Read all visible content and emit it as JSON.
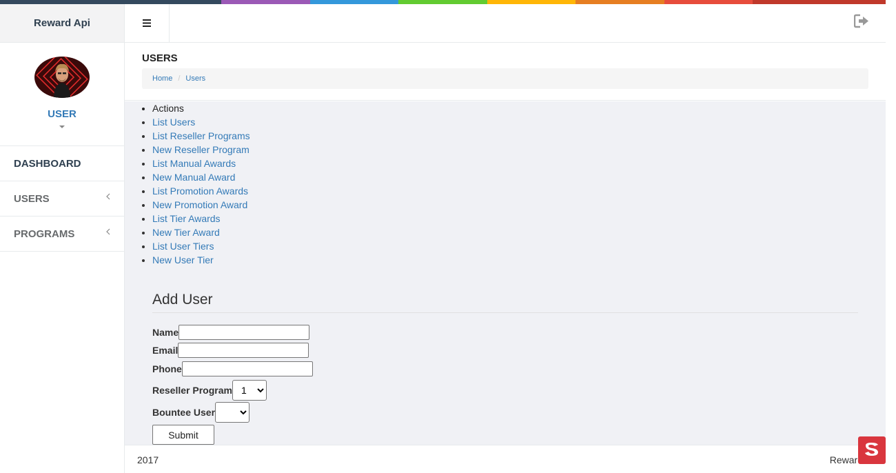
{
  "brand": {
    "name": "Reward Api"
  },
  "profile": {
    "name": "USER"
  },
  "colors": [
    "#34495e",
    "#9b59b6",
    "#3498db",
    "#62cb31",
    "#ffb606",
    "#e67e22",
    "#e74c3c",
    "#c0392b"
  ],
  "sidebar": {
    "items": [
      {
        "label": "DASHBOARD"
      },
      {
        "label": "USERS"
      },
      {
        "label": "PROGRAMS"
      }
    ]
  },
  "page": {
    "title": "USERS",
    "breadcrumb": [
      "Home",
      "Users"
    ]
  },
  "actions": {
    "heading": "Actions",
    "links": [
      "List Users",
      "List Reseller Programs",
      "New Reseller Program",
      "List Manual Awards",
      "New Manual Award",
      "List Promotion Awards",
      "New Promotion Award",
      "List Tier Awards",
      "New Tier Award",
      "List User Tiers",
      "New User Tier"
    ]
  },
  "form": {
    "title": "Add User",
    "name_label": "Name",
    "name_value": "",
    "email_label": "Email",
    "email_value": "",
    "phone_label": "Phone",
    "phone_value": "",
    "reseller_label": "Reseller Program",
    "reseller_selected": "1",
    "bountee_label": "Bountee User",
    "bountee_selected": "",
    "submit_label": "Submit"
  },
  "footer": {
    "left": "2017",
    "right": "Rewards"
  }
}
